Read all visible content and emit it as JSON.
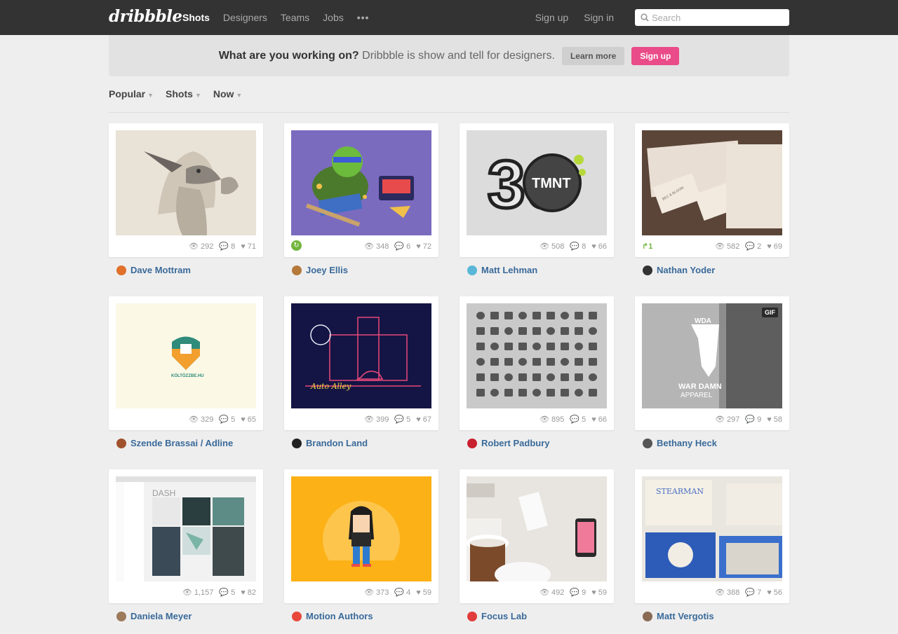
{
  "topbar": {
    "logo": "dribbble",
    "nav": [
      "Shots",
      "Designers",
      "Teams",
      "Jobs"
    ],
    "more": "•••",
    "signup": "Sign up",
    "signin": "Sign in",
    "search_placeholder": "Search"
  },
  "banner": {
    "question": "What are you working on?",
    "tagline": " Dribbble is show and tell for designers.",
    "learn_more": "Learn more",
    "signup": "Sign up"
  },
  "filters": [
    "Popular",
    "Shots",
    "Now"
  ],
  "colors": {
    "brand_pink": "#ea4c89",
    "link_blue": "#3a6a9a",
    "rebound_green": "#72b53e"
  },
  "shots": [
    {
      "author": "Dave Mottram",
      "views": "292",
      "comments": "8",
      "likes": "71",
      "rebound": "",
      "thumb": "sketch-creature",
      "avatar_color": "#e0702a"
    },
    {
      "author": "Joey Ellis",
      "views": "348",
      "comments": "6",
      "likes": "72",
      "rebound": "icon",
      "thumb": "ninja-turtle",
      "avatar_color": "#b5793a"
    },
    {
      "author": "Matt Lehman",
      "views": "508",
      "comments": "8",
      "likes": "66",
      "rebound": "",
      "thumb": "tmnt-30",
      "avatar_color": "#5ab7d8"
    },
    {
      "author": "Nathan Yoder",
      "views": "582",
      "comments": "2",
      "likes": "69",
      "rebound": "1",
      "thumb": "business-cards",
      "avatar_color": "#333333"
    },
    {
      "author": "Szende Brassai / Adline",
      "views": "329",
      "comments": "5",
      "likes": "65",
      "rebound": "",
      "thumb": "koltozzbe",
      "avatar_color": "#a0522d"
    },
    {
      "author": "Brandon Land",
      "views": "399",
      "comments": "5",
      "likes": "67",
      "rebound": "",
      "thumb": "auto-alley",
      "avatar_color": "#222222"
    },
    {
      "author": "Robert Padbury",
      "views": "895",
      "comments": "5",
      "likes": "66",
      "rebound": "",
      "thumb": "icon-grid",
      "avatar_color": "#c8202e"
    },
    {
      "author": "Bethany Heck",
      "views": "297",
      "comments": "9",
      "likes": "58",
      "rebound": "",
      "thumb": "war-damn",
      "avatar_color": "#555555",
      "gif": "GIF"
    },
    {
      "author": "Daniela Meyer",
      "views": "1,157",
      "comments": "5",
      "likes": "82",
      "rebound": "",
      "thumb": "dash-ui",
      "avatar_color": "#9c7a5a"
    },
    {
      "author": "Motion Authors",
      "views": "373",
      "comments": "4",
      "likes": "59",
      "rebound": "",
      "thumb": "rocker",
      "avatar_color": "#e8473c"
    },
    {
      "author": "Focus Lab",
      "views": "492",
      "comments": "9",
      "likes": "59",
      "rebound": "",
      "thumb": "coffee-phone",
      "avatar_color": "#e23b3b"
    },
    {
      "author": "Matt Vergotis",
      "views": "388",
      "comments": "7",
      "likes": "56",
      "rebound": "",
      "thumb": "stearman",
      "avatar_color": "#8a6a55"
    }
  ],
  "thumb_text": {
    "koltozzbe": "KÖLTÖZZBE.HU",
    "auto_alley": "Auto Alley",
    "tmnt": "TMNT",
    "thirty": "30",
    "wda": "WDA",
    "war_damn": "WAR DAMN",
    "apparel": "APPAREL",
    "dash": "DASH",
    "stearman": "STEARMAN",
    "bec_bloom": "BEC & BLOOM"
  }
}
